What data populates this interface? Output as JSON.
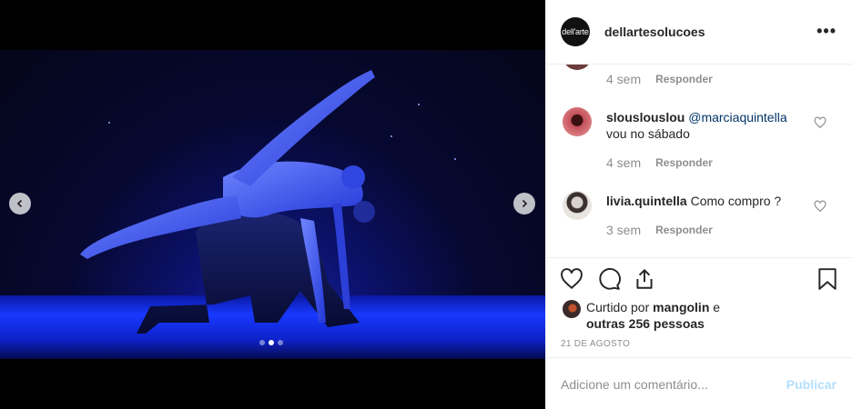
{
  "post": {
    "author": "dellartesolucoes",
    "logo_text": "dell'arte",
    "more_label": "•••",
    "carousel": {
      "slide_count": 3,
      "active_slide": 2
    }
  },
  "comments": {
    "previous": {
      "time": "4 sem",
      "reply": "Responder"
    },
    "items": [
      {
        "username": "slouslouslou",
        "mention": "@marciaquintella",
        "text": "vou no sábado",
        "time": "4 sem",
        "reply": "Responder"
      },
      {
        "username": "livia.quintella",
        "mention": "",
        "text": "Como compro ?",
        "time": "3 sem",
        "reply": "Responder"
      }
    ]
  },
  "likes": {
    "prefix": "Curtido por",
    "user": "mangolin",
    "joiner": "e",
    "others": "outras 256 pessoas"
  },
  "date": "21 DE AGOSTO",
  "add_comment": {
    "placeholder": "Adicione um comentário...",
    "publish_label": "Publicar"
  },
  "icons": {
    "like": "heart-icon",
    "comment": "comment-bubble-icon",
    "share": "share-icon",
    "save": "bookmark-icon",
    "prev": "chevron-left-icon",
    "next": "chevron-right-icon"
  },
  "colors": {
    "text": "#262626",
    "secondary": "#8e8e8e",
    "mention": "#003569",
    "publish_disabled": "#b2dffc",
    "stage_blue": "#1838ff"
  }
}
